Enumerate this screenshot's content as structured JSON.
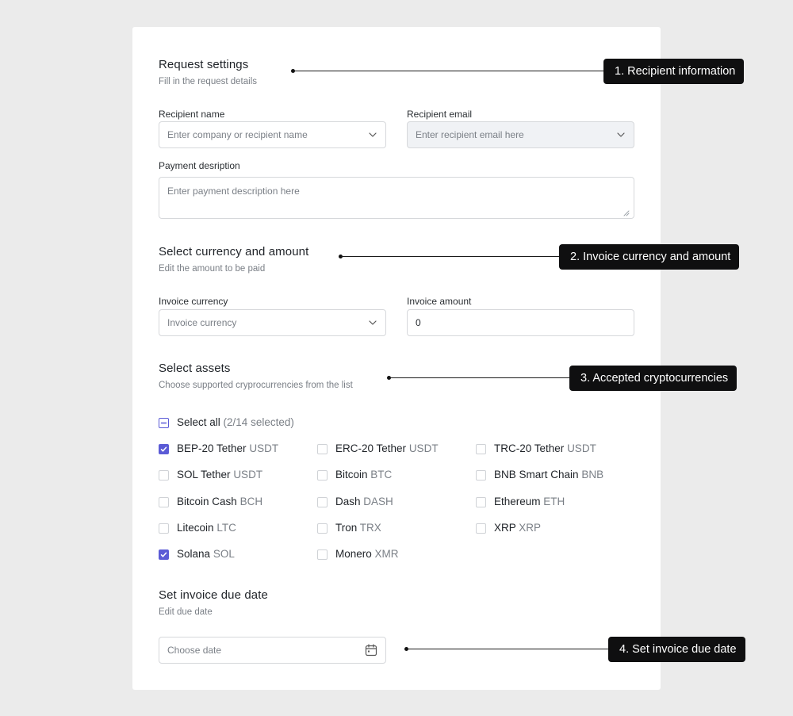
{
  "request_settings": {
    "title": "Request settings",
    "subtitle": "Fill in the request details",
    "recipient_name": {
      "label": "Recipient name",
      "placeholder": "Enter company or recipient name"
    },
    "recipient_email": {
      "label": "Recipient email",
      "placeholder": "Enter recipient email here"
    },
    "payment_description": {
      "label": "Payment desription",
      "placeholder": "Enter payment description here"
    }
  },
  "currency": {
    "title": "Select currency and amount",
    "subtitle": "Edit the amount to be paid",
    "invoice_currency": {
      "label": "Invoice currency",
      "placeholder": "Invoice currency"
    },
    "invoice_amount": {
      "label": "Invoice amount",
      "value": "0"
    }
  },
  "assets": {
    "title": "Select assets",
    "subtitle": "Choose supported cryprocurrencies from the list",
    "select_all": {
      "label": "Select all",
      "count": "(2/14 selected)"
    },
    "items": [
      {
        "name": "BEP-20 Tether",
        "ticker": "USDT",
        "checked": true
      },
      {
        "name": "ERC-20 Tether",
        "ticker": "USDT",
        "checked": false
      },
      {
        "name": "TRC-20 Tether",
        "ticker": "USDT",
        "checked": false
      },
      {
        "name": "SOL Tether",
        "ticker": "USDT",
        "checked": false
      },
      {
        "name": "Bitcoin",
        "ticker": "BTC",
        "checked": false
      },
      {
        "name": "BNB Smart Chain",
        "ticker": "BNB",
        "checked": false
      },
      {
        "name": "Bitcoin Cash",
        "ticker": "BCH",
        "checked": false
      },
      {
        "name": "Dash",
        "ticker": "DASH",
        "checked": false
      },
      {
        "name": "Ethereum",
        "ticker": "ETH",
        "checked": false
      },
      {
        "name": "Litecoin",
        "ticker": "LTC",
        "checked": false
      },
      {
        "name": "Tron",
        "ticker": "TRX",
        "checked": false
      },
      {
        "name": "XRP",
        "ticker": "XRP",
        "checked": false
      },
      {
        "name": "Solana",
        "ticker": "SOL",
        "checked": true
      },
      {
        "name": "Monero",
        "ticker": "XMR",
        "checked": false
      }
    ]
  },
  "due_date": {
    "title": "Set invoice due date",
    "subtitle": "Edit due date",
    "placeholder": "Choose date"
  },
  "callouts": [
    "1. Recipient information",
    "2. Invoice currency and amount",
    "3. Accepted cryptocurrencies",
    "4. Set invoice due date"
  ],
  "colors": {
    "accent": "#5b5bd6",
    "background": "#ebebeb",
    "callout": "#0f0f10"
  },
  "icons": {
    "dropdown": "chevron-down-icon",
    "date": "calendar-icon",
    "checkbox_checked": "checkmark-icon",
    "select_all": "indeterminate-icon"
  }
}
